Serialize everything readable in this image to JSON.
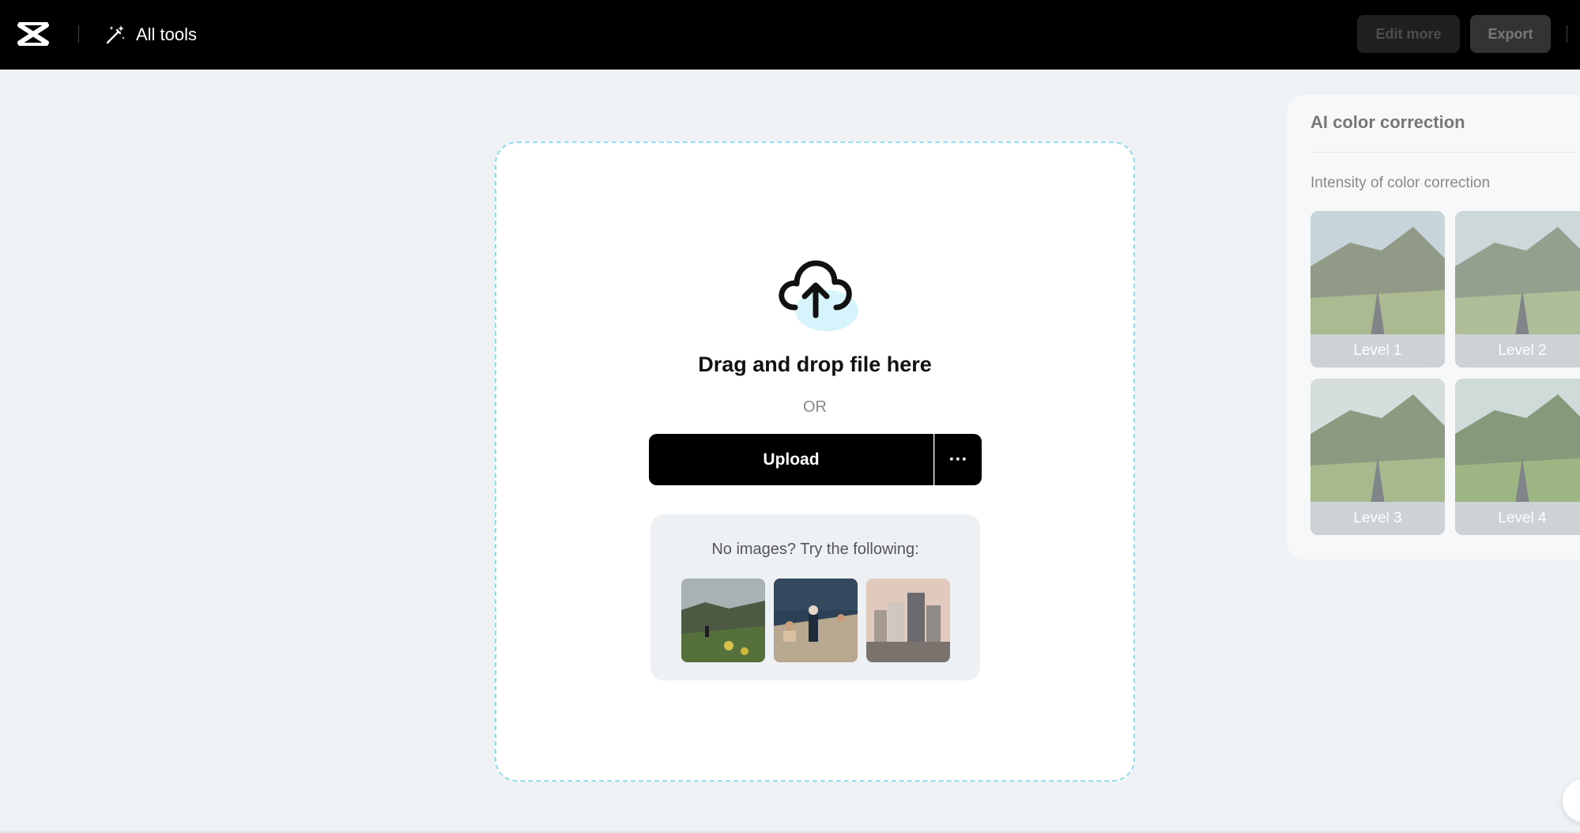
{
  "topbar": {
    "logo_icon": "capcut-logo-icon",
    "all_tools_label": "All tools",
    "edit_more_label": "Edit more",
    "export_label": "Export"
  },
  "dropzone": {
    "icon": "cloud-upload-icon",
    "drag_text": "Drag and drop file here",
    "or_text": "OR",
    "upload_label": "Upload",
    "more_label": "···",
    "samples_text": "No images? Try the following:",
    "samples": [
      "sample-landscape",
      "sample-people-sea",
      "sample-city"
    ]
  },
  "panel": {
    "title": "AI color correction",
    "subtitle": "Intensity of color correction",
    "levels": [
      "Level 1",
      "Level 2",
      "Level 3",
      "Level 4"
    ]
  },
  "colors": {
    "topbar_bg": "#000000",
    "dropzone_border": "#8fdcec",
    "cloud_accent": "#d6f4fb"
  }
}
